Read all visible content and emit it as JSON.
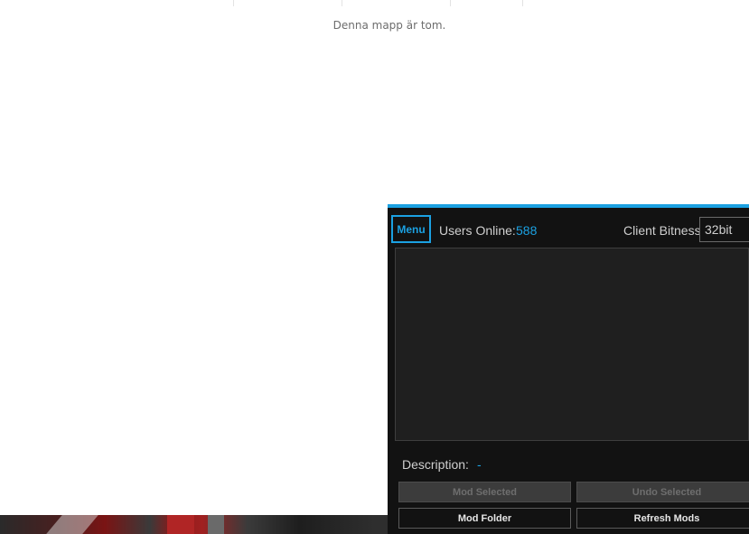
{
  "explorer": {
    "empty_message": "Denna mapp är tom."
  },
  "mod_tool": {
    "menu_label": "Menu",
    "users_online_label": "Users Online:",
    "users_online_count": "588",
    "client_bitness_label": "Client Bitness",
    "client_bitness_value": "32bit",
    "description_label": "Description:",
    "description_value": "-",
    "buttons": {
      "mod_selected": "Mod Selected",
      "undo_selected": "Undo Selected",
      "mod_folder": "Mod Folder",
      "refresh_mods": "Refresh Mods"
    },
    "accent_color": "#1ba1e2"
  }
}
